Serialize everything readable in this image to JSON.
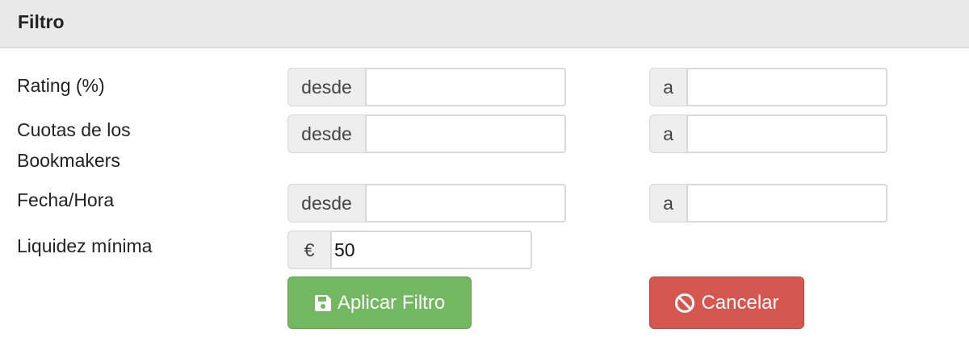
{
  "panel": {
    "title": "Filtro"
  },
  "rows": [
    {
      "label": "Rating (%)",
      "from_addon": "desde",
      "from_value": "",
      "to_addon": "a",
      "to_value": ""
    },
    {
      "label_line1": "Cuotas de los",
      "label_line2": "Bookmakers",
      "from_addon": "desde",
      "from_value": "",
      "to_addon": "a",
      "to_value": ""
    },
    {
      "label": "Fecha/Hora",
      "from_addon": "desde",
      "from_value": "",
      "to_addon": "a",
      "to_value": ""
    }
  ],
  "liquidity": {
    "label": "Liquidez mínima",
    "currency": "€",
    "value": "50"
  },
  "buttons": {
    "apply": {
      "label": "Aplicar Filtro",
      "icon": "save-icon",
      "color": "#73b760"
    },
    "cancel": {
      "label": "Cancelar",
      "icon": "ban-icon",
      "color": "#d55750"
    }
  }
}
